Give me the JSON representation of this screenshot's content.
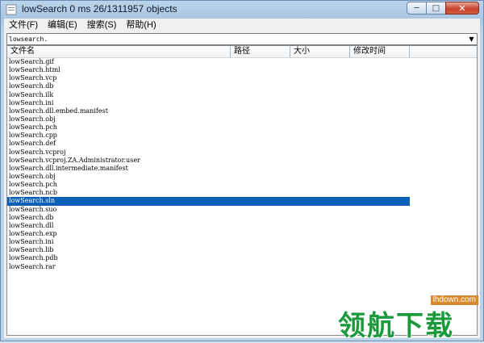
{
  "window": {
    "title": "lowSearch 0 ms 26/1311957 objects",
    "min_glyph": "─",
    "max_glyph": "□",
    "close_glyph": "✕"
  },
  "menu": [
    {
      "label": "文件(F)"
    },
    {
      "label": "编辑(E)"
    },
    {
      "label": "搜索(S)"
    },
    {
      "label": "帮助(H)"
    }
  ],
  "search": {
    "value": "lowsearch.",
    "dropdown_glyph": "▼"
  },
  "columns": [
    {
      "label": "文件名"
    },
    {
      "label": "路径"
    },
    {
      "label": "大小"
    },
    {
      "label": "修改时间"
    }
  ],
  "files": [
    "lowSearch.gif",
    "lowSearch.html",
    "lowSearch.vcp",
    "lowSearch.db",
    "lowSearch.ilk",
    "lowSearch.ini",
    "lowSearch.dll.embed.manifest",
    "lowSearch.obj",
    "lowSearch.pch",
    "lowSearch.cpp",
    "lowSearch.def",
    "lowSearch.vcproj",
    "lowSearch.vcproj.ZA.Administrator.user",
    "lowSearch.dll.intermediate.manifest",
    "lowSearch.obj",
    "lowSearch.pch",
    "lowSearch.ncb",
    "lowSearch.sln",
    "lowSearch.suo",
    "lowSearch.db",
    "lowSearch.dll",
    "lowSearch.exp",
    "lowSearch.ini",
    "lowSearch.lib",
    "lowSearch.pdb",
    "lowSearch.rar"
  ],
  "selected_index": 17,
  "colors": {
    "selection": "#0a60b8",
    "watermark_green": "#1b9a3b",
    "watermark_orange": "#d58a30"
  },
  "watermark": {
    "url": "lhdown.com",
    "text": "领航下载"
  }
}
